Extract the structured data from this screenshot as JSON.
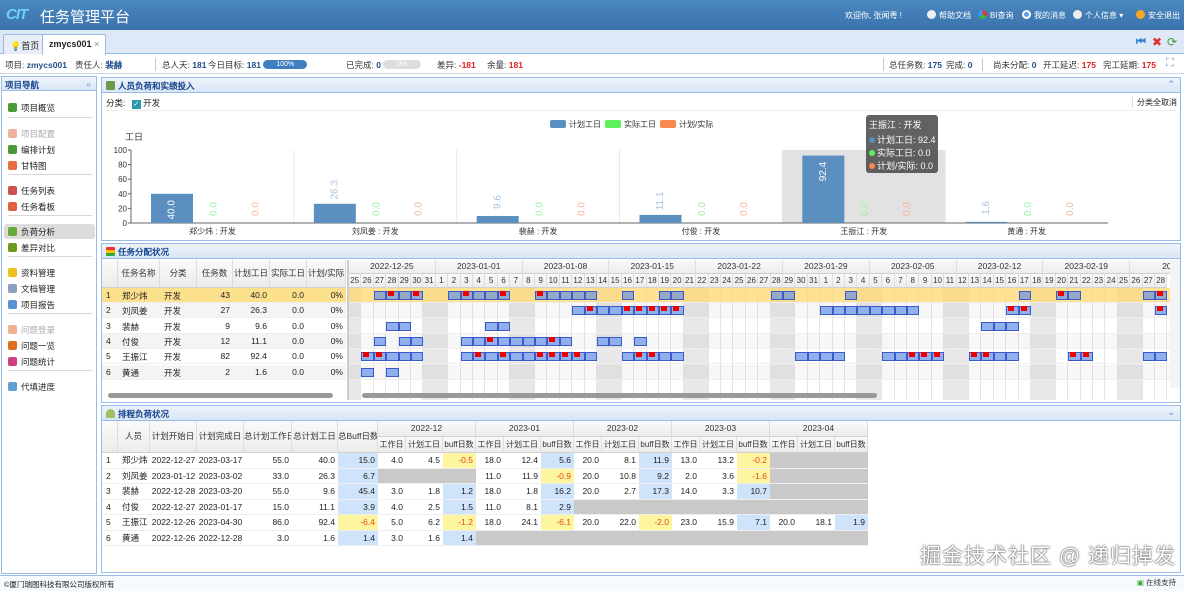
{
  "header": {
    "logo": "CIT",
    "title": "任务管理平台",
    "welcome": "欢迎你, 张闻粤 !",
    "nav": [
      {
        "label": "帮助文档",
        "icon": "help-icon",
        "color": "#ffffff"
      },
      {
        "label": "BI查询",
        "icon": "bi-chart-icon",
        "color": "#3cb44b"
      },
      {
        "label": "我的消息",
        "icon": "message-icon",
        "color": "#5aa0f0"
      },
      {
        "label": "个人信息 ▾",
        "icon": "user-icon",
        "color": "#ffffff"
      },
      {
        "label": "安全退出",
        "icon": "logout-icon",
        "color": "#f5a623"
      }
    ]
  },
  "tabs": [
    {
      "label": "首页",
      "icon": "bulb-icon"
    },
    {
      "label": "zmycs001",
      "close": "×"
    }
  ],
  "infobar": {
    "project_label": "项目:",
    "project": "zmycs001",
    "owner_label": "责任人:",
    "owner": "裴赫",
    "total_days_label": "总人天:",
    "total_days": "181",
    "today_target_label": "今日目标:",
    "today_target": "181",
    "today_progress": "100%",
    "done_label": "已完成:",
    "done": "0",
    "done_progress": "0%",
    "diff_label": "差异:",
    "diff": "-181",
    "remain_label": "余量:",
    "remain": "181",
    "total_tasks_label": "总任务数:",
    "total_tasks": "175",
    "complete_label": "完成:",
    "complete": "0",
    "unassigned_label": "尚未分配:",
    "unassigned": "0",
    "start_delay_label": "开工延迟:",
    "start_delay": "175",
    "finish_delay_label": "完工延期:",
    "finish_delay": "175"
  },
  "sidebar": {
    "title": "项目导航",
    "collapse": "«",
    "items": [
      {
        "label": "项目概览",
        "color": "#4a9a3a"
      },
      {
        "label": "项目配置",
        "color": "#f0b0a0",
        "disabled": true
      },
      {
        "label": "编排计划",
        "color": "#4a9a3a"
      },
      {
        "label": "甘特图",
        "color": "#e87040"
      },
      {
        "label": "任务列表",
        "color": "#d05050"
      },
      {
        "label": "任务看板",
        "color": "#e06040"
      },
      {
        "label": "负荷分析",
        "color": "#6aaa3a",
        "selected": true
      },
      {
        "label": "差异对比",
        "color": "#6a9a20"
      },
      {
        "label": "资料管理",
        "color": "#f0c020"
      },
      {
        "label": "文档管理",
        "color": "#8aa0c0"
      },
      {
        "label": "项目报告",
        "color": "#5a90d0"
      },
      {
        "label": "问题登录",
        "color": "#f0b090",
        "disabled": true
      },
      {
        "label": "问题一览",
        "color": "#e07020"
      },
      {
        "label": "问题统计",
        "color": "#d04080"
      },
      {
        "label": "代填进度",
        "color": "#60a0d0"
      }
    ]
  },
  "load_panel": {
    "title": "人员负荷和实绩投入",
    "filter_label": "分类:",
    "filter_option": "开发",
    "clear_button": "分类全取消"
  },
  "chart_data": {
    "type": "bar",
    "ylabel": "工日",
    "ylim": [
      0,
      100
    ],
    "yticks": [
      0,
      20,
      40,
      60,
      80,
      100
    ],
    "legend_position": "top-center",
    "categories": [
      "郑少炜 : 开发",
      "刘凤姜 : 开发",
      "裴赫 : 开发",
      "付俊 : 开发",
      "王振江 : 开发",
      "黄通 : 开发"
    ],
    "series": [
      {
        "name": "计划工日",
        "color": "#5b8fc0",
        "values": [
          40.0,
          26.3,
          9.6,
          11.1,
          92.4,
          1.6
        ]
      },
      {
        "name": "实际工日",
        "color": "#5cf05c",
        "values": [
          0.0,
          0.0,
          0.0,
          0.0,
          0.0,
          0.0
        ]
      },
      {
        "name": "计划/实际",
        "color": "#f7894f",
        "values": [
          0.0,
          0.0,
          0.0,
          0.0,
          0.0,
          0.0
        ]
      }
    ],
    "highlighted_category": "王振江 : 开发",
    "tooltip": {
      "title": "王振江 : 开发",
      "lines": [
        "计划工日: 92.4",
        "实际工日: 0.0",
        "计划/实际: 0.0"
      ]
    }
  },
  "assign_panel": {
    "title": "任务分配状况",
    "columns": [
      "",
      "任务名称",
      "分类",
      "任务数",
      "计划工日",
      "实际工日",
      "计划/实际"
    ],
    "rows": [
      [
        "1",
        "郑少炜",
        "开发",
        "43",
        "40.0",
        "0.0",
        "0%"
      ],
      [
        "2",
        "刘凤姜",
        "开发",
        "27",
        "26.3",
        "0.0",
        "0%"
      ],
      [
        "3",
        "裴赫",
        "开发",
        "9",
        "9.6",
        "0.0",
        "0%"
      ],
      [
        "4",
        "付俊",
        "开发",
        "12",
        "11.1",
        "0.0",
        "0%"
      ],
      [
        "5",
        "王振江",
        "开发",
        "82",
        "92.4",
        "0.0",
        "0%"
      ],
      [
        "6",
        "黄通",
        "开发",
        "2",
        "1.6",
        "0.0",
        "0%"
      ]
    ],
    "selected_row": 0,
    "gantt": {
      "weeks": [
        "2022-12-25",
        "2023-01-01",
        "2023-01-08",
        "2023-01-15",
        "2023-01-22",
        "2023-01-29",
        "2023-02-05",
        "2023-02-12",
        "2023-02-19",
        "2023-"
      ],
      "days": [
        "25",
        "26",
        "27",
        "28",
        "29",
        "30",
        "31",
        "1",
        "2",
        "3",
        "4",
        "5",
        "6",
        "7",
        "8",
        "9",
        "10",
        "11",
        "12",
        "13",
        "14",
        "15",
        "16",
        "17",
        "18",
        "19",
        "20",
        "21",
        "22",
        "23",
        "24",
        "25",
        "26",
        "27",
        "28",
        "29",
        "30",
        "31",
        "1",
        "2",
        "3",
        "4",
        "5",
        "6",
        "7",
        "8",
        "9",
        "10",
        "11",
        "12",
        "13",
        "14",
        "15",
        "16",
        "17",
        "18",
        "19",
        "20",
        "21",
        "22",
        "23",
        "24",
        "25",
        "26",
        "27",
        "28"
      ],
      "start": "2022-12-25",
      "bar_color": "#8fb0ec",
      "mark_color": "#ee0000",
      "rows": [
        {
          "bars": [
            [
              "12-27",
              "12-30"
            ],
            [
              "01-02",
              "01-06"
            ],
            [
              "01-09",
              "01-13"
            ],
            [
              "01-16",
              "01-16"
            ],
            [
              "01-19",
              "01-20"
            ],
            [
              "01-28",
              "01-29"
            ],
            [
              "02-03",
              "02-03"
            ],
            [
              "02-17",
              "02-17"
            ],
            [
              "02-20",
              "02-21"
            ],
            [
              "02-27",
              "02-28"
            ]
          ],
          "marks": [
            "12-28",
            "12-30",
            "01-03",
            "01-06",
            "01-09",
            "02-20",
            "02-28"
          ]
        },
        {
          "bars": [
            [
              "01-12",
              "01-20"
            ],
            [
              "02-01",
              "02-08"
            ],
            [
              "02-16",
              "02-17"
            ],
            [
              "02-28",
              "02-28"
            ]
          ],
          "marks": [
            "01-13",
            "01-16",
            "01-17",
            "01-18",
            "01-19",
            "01-20",
            "02-16",
            "02-17",
            "02-28"
          ]
        },
        {
          "bars": [
            [
              "12-28",
              "12-29"
            ],
            [
              "01-05",
              "01-06"
            ],
            [
              "02-14",
              "02-16"
            ]
          ],
          "marks": []
        },
        {
          "bars": [
            [
              "12-27",
              "12-27"
            ],
            [
              "12-29",
              "12-30"
            ],
            [
              "01-03",
              "01-11"
            ],
            [
              "01-14",
              "01-15"
            ],
            [
              "01-17",
              "01-17"
            ]
          ],
          "marks": [
            "01-05",
            "01-10"
          ]
        },
        {
          "bars": [
            [
              "12-26",
              "12-30"
            ],
            [
              "01-03",
              "01-13"
            ],
            [
              "01-16",
              "01-20"
            ],
            [
              "01-30",
              "02-02"
            ],
            [
              "02-06",
              "02-10"
            ],
            [
              "02-13",
              "02-16"
            ],
            [
              "02-21",
              "02-22"
            ],
            [
              "02-27",
              "02-28"
            ]
          ],
          "marks": [
            "12-26",
            "12-27",
            "01-04",
            "01-06",
            "01-09",
            "01-10",
            "01-11",
            "01-12",
            "01-17",
            "01-18",
            "02-08",
            "02-09",
            "02-10",
            "02-13",
            "02-14",
            "02-21",
            "02-22"
          ]
        },
        {
          "bars": [
            [
              "12-26",
              "12-26"
            ],
            [
              "12-28",
              "12-28"
            ]
          ],
          "marks": []
        }
      ]
    }
  },
  "schedule_panel": {
    "title": "排程负荷状况",
    "columns": [
      "",
      "人员",
      "计划开始日",
      "计划完成日",
      "总计划工作日",
      "总计划工日",
      "总Buff日数"
    ],
    "months": [
      "2022-12",
      "2023-01",
      "2023-02",
      "2023-03",
      "2023-04"
    ],
    "sub_columns": [
      "工作日",
      "计划工日",
      "buff日数"
    ],
    "rows": [
      {
        "no": "1",
        "name": "郑少炜",
        "start": "2022-12-27",
        "end": "2023-03-17",
        "work": "55.0",
        "plan": "40.0",
        "buff": "15.0",
        "months": [
          [
            "4.0",
            "4.5",
            "-0.5"
          ],
          [
            "18.0",
            "12.4",
            "5.6"
          ],
          [
            "20.0",
            "8.1",
            "11.9"
          ],
          [
            "13.0",
            "13.2",
            "-0.2"
          ],
          null
        ]
      },
      {
        "no": "2",
        "name": "刘凤姜",
        "start": "2023-01-12",
        "end": "2023-03-02",
        "work": "33.0",
        "plan": "26.3",
        "buff": "6.7",
        "months": [
          null,
          [
            "11.0",
            "11.9",
            "-0.9"
          ],
          [
            "20.0",
            "10.8",
            "9.2"
          ],
          [
            "2.0",
            "3.6",
            "-1.6"
          ],
          null
        ]
      },
      {
        "no": "3",
        "name": "裴赫",
        "start": "2022-12-28",
        "end": "2023-03-20",
        "work": "55.0",
        "plan": "9.6",
        "buff": "45.4",
        "months": [
          [
            "3.0",
            "1.8",
            "1.2"
          ],
          [
            "18.0",
            "1.8",
            "16.2"
          ],
          [
            "20.0",
            "2.7",
            "17.3"
          ],
          [
            "14.0",
            "3.3",
            "10.7"
          ],
          null
        ]
      },
      {
        "no": "4",
        "name": "付俊",
        "start": "2022-12-27",
        "end": "2023-01-17",
        "work": "15.0",
        "plan": "11.1",
        "buff": "3.9",
        "months": [
          [
            "4.0",
            "2.5",
            "1.5"
          ],
          [
            "11.0",
            "8.1",
            "2.9"
          ],
          null,
          null,
          null
        ]
      },
      {
        "no": "5",
        "name": "王振江",
        "start": "2022-12-26",
        "end": "2023-04-30",
        "work": "86.0",
        "plan": "92.4",
        "buff": "-6.4",
        "months": [
          [
            "5.0",
            "6.2",
            "-1.2"
          ],
          [
            "18.0",
            "24.1",
            "-6.1"
          ],
          [
            "20.0",
            "22.0",
            "-2.0"
          ],
          [
            "23.0",
            "15.9",
            "7.1"
          ],
          [
            "20.0",
            "18.1",
            "1.9"
          ]
        ]
      },
      {
        "no": "6",
        "name": "黄通",
        "start": "2022-12-26",
        "end": "2022-12-28",
        "work": "3.0",
        "plan": "1.6",
        "buff": "1.4",
        "months": [
          [
            "3.0",
            "1.6",
            "1.4"
          ],
          null,
          null,
          null,
          null
        ]
      }
    ]
  },
  "watermark": "掘金技术社区 @ 递归掉发",
  "footer": {
    "copyright": "©厦门瑞图科技有限公司版权所有",
    "support": "在线支持"
  }
}
